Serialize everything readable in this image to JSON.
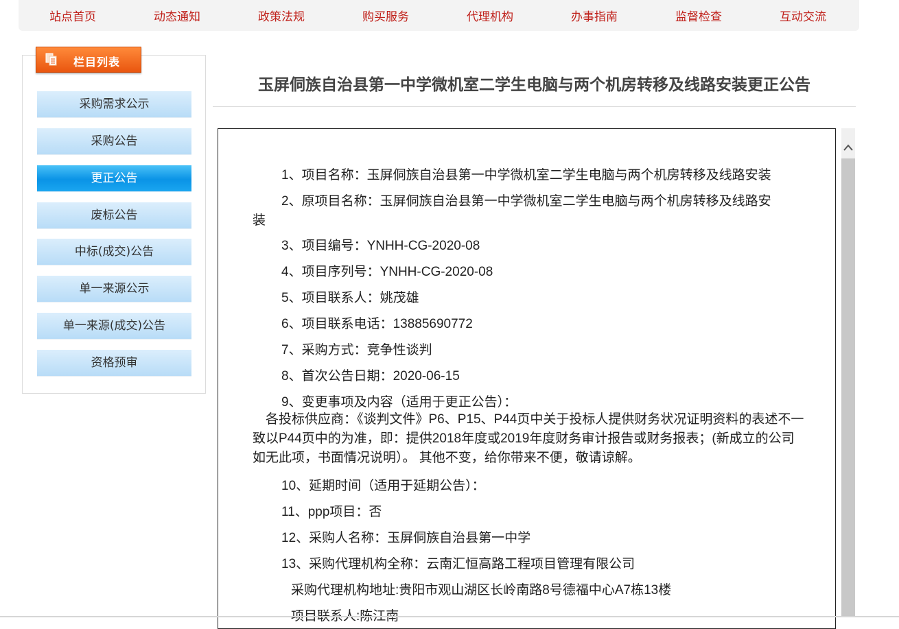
{
  "nav": {
    "items": [
      "站点首页",
      "动态通知",
      "政策法规",
      "购买服务",
      "代理机构",
      "办事指南",
      "监督检查",
      "互动交流"
    ]
  },
  "sidebar": {
    "header": "栏目列表",
    "items": [
      {
        "label": "采购需求公示",
        "active": false
      },
      {
        "label": "采购公告",
        "active": false
      },
      {
        "label": "更正公告",
        "active": true
      },
      {
        "label": "废标公告",
        "active": false
      },
      {
        "label": "中标(成交)公告",
        "active": false
      },
      {
        "label": "单一来源公示",
        "active": false
      },
      {
        "label": "单一来源(成交)公告",
        "active": false
      },
      {
        "label": "资格预审",
        "active": false
      }
    ]
  },
  "article": {
    "title": "玉屏侗族自治县第一中学微机室二学生电脑与两个机房转移及线路安装更正公告",
    "lines": {
      "l1": "1、项目名称：玉屏侗族自治县第一中学微机室二学生电脑与两个机房转移及线路安装",
      "l2a": "2、原项目名称：玉屏侗族自治县第一中学微机室二学生电脑与两个机房转移及线路安",
      "l2b": "装",
      "l3": "3、项目编号：YNHH-CG-2020-08",
      "l4": "4、项目序列号：YNHH-CG-2020-08",
      "l5": "5、项目联系人：姚茂雄",
      "l6": "6、项目联系电话：13885690772",
      "l7": "7、采购方式：竞争性谈判",
      "l8": "8、首次公告日期：2020-06-15",
      "l9": "9、变更事项及内容（适用于更正公告）：",
      "l9body": "　各投标供应商：《谈判文件》P6、P15、P44页中关于投标人提供财务状况证明资料的表述不一致以P44页中的为准，即：提供2018年度或2019年度财务审计报告或财务报表；(新成立的公司如无此项，书面情况说明）。 其他不变，给你带来不便，敬请谅解。",
      "l10": "10、延期时间（适用于延期公告）：",
      "l11": "11、ppp项目：否",
      "l12": "12、采购人名称：玉屏侗族自治县第一中学",
      "l13": "13、采购代理机构全称：云南汇恒高路工程项目管理有限公司",
      "l14": "采购代理机构地址:贵阳市观山湖区长岭南路8号德福中心A7栋13楼",
      "l15": "项目联系人:陈江南"
    }
  },
  "icons": {
    "sidebar_header_icon": "documents-icon",
    "scroll_up_icon": "chevron-up-icon"
  },
  "colors": {
    "nav_text": "#c0211b",
    "sidebar_header_bg": "#f26d21",
    "active_item_bg": "#0a93e6"
  }
}
